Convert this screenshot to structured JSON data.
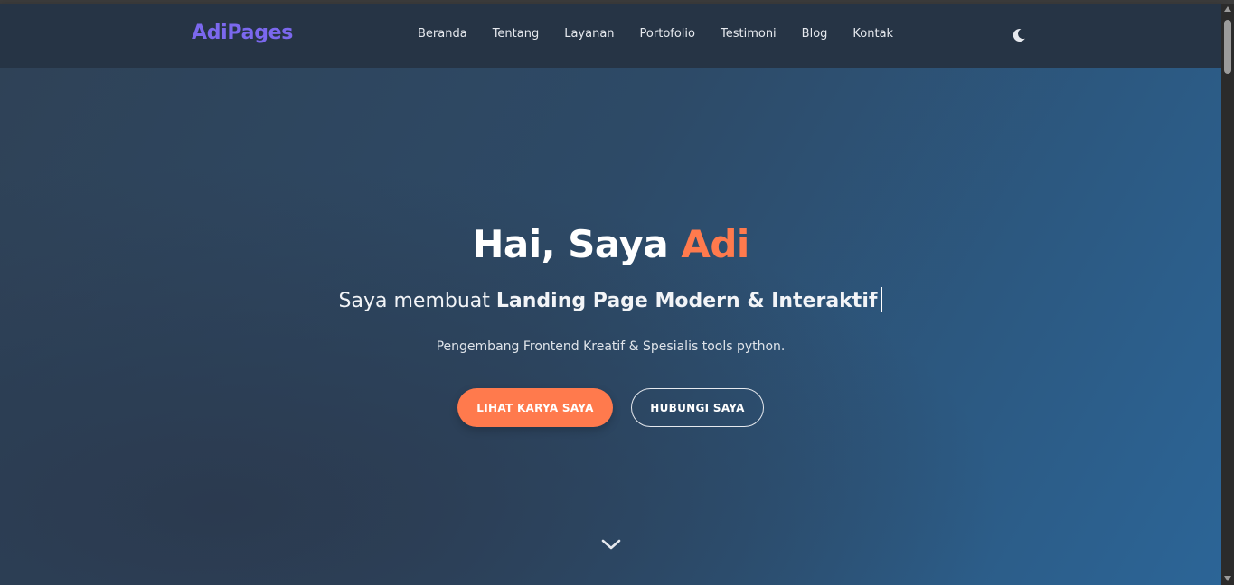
{
  "brand": {
    "logo_text": "AdiPages",
    "logo_color": "#7b68ee"
  },
  "nav": {
    "links": [
      "Beranda",
      "Tentang",
      "Layanan",
      "Portofolio",
      "Testimoni",
      "Blog",
      "Kontak"
    ],
    "theme_icon": "moon-icon"
  },
  "hero": {
    "title_prefix": "Hai, Saya ",
    "title_accent": "Adi",
    "subtitle_prefix": "Saya membuat ",
    "subtitle_strong": "Landing Page Modern & Interaktif",
    "description": "Pengembang Frontend Kreatif & Spesialis tools python.",
    "primary_button": "LIHAT KARYA SAYA",
    "secondary_button": "HUBUNGI SAYA",
    "scroll_icon": "chevron-down-icon"
  },
  "colors": {
    "accent": "#ff7a4d",
    "navbar_bg": "#263445",
    "text": "#ffffff"
  }
}
